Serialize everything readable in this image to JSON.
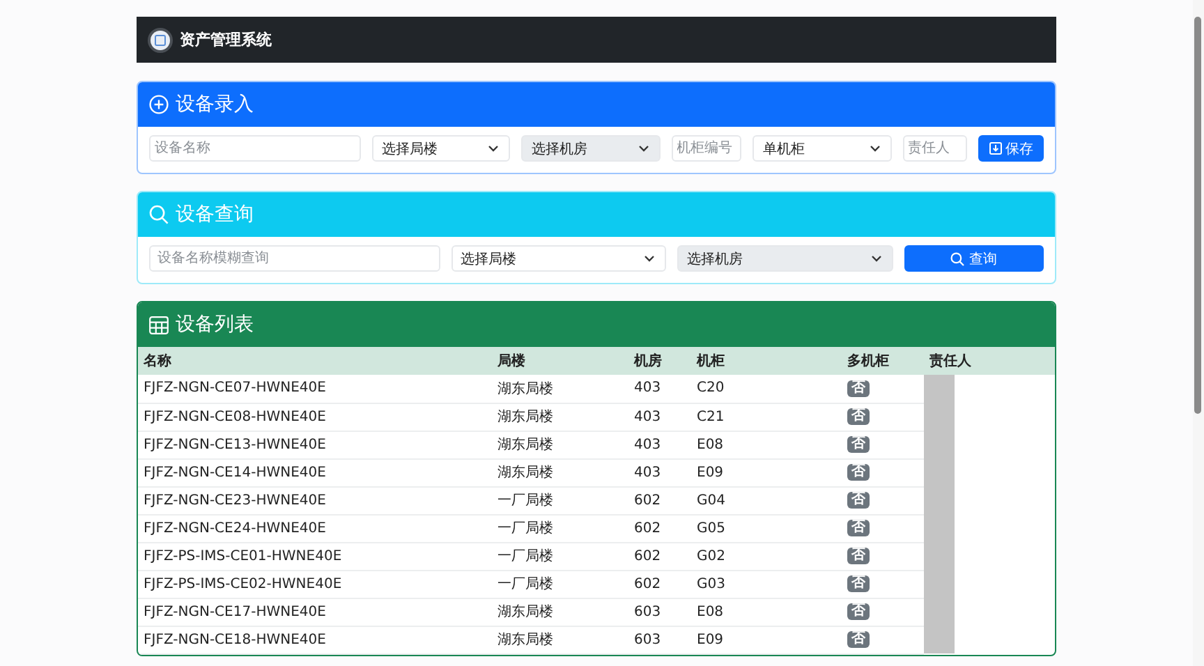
{
  "navbar": {
    "title": "资产管理系统"
  },
  "entry_form": {
    "title": "设备录入",
    "name_field": {
      "placeholder": "设备名称"
    },
    "building_select": {
      "value": "选择局楼",
      "disabled": false
    },
    "room_select": {
      "value": "选择机房",
      "disabled": true
    },
    "cabinet_field": {
      "placeholder": "机柜编号"
    },
    "cabinet_type_select": {
      "value": "单机柜",
      "disabled": false
    },
    "owner_field": {
      "placeholder": "责任人"
    },
    "save_button": "保存"
  },
  "query_form": {
    "title": "设备查询",
    "name_field": {
      "placeholder": "设备名称模糊查询"
    },
    "building_select": {
      "value": "选择局楼",
      "disabled": false
    },
    "room_select": {
      "value": "选择机房",
      "disabled": true
    },
    "query_button": "查询"
  },
  "device_list": {
    "title": "设备列表",
    "columns": [
      "名称",
      "局楼",
      "机房",
      "机柜",
      "多机柜",
      "责任人"
    ],
    "rows": [
      {
        "name": "FJFZ-NGN-CE07-HWNE40E",
        "building": "湖东局楼",
        "room": "403",
        "cabinet": "C20",
        "multi_cabinet": "否"
      },
      {
        "name": "FJFZ-NGN-CE08-HWNE40E",
        "building": "湖东局楼",
        "room": "403",
        "cabinet": "C21",
        "multi_cabinet": "否"
      },
      {
        "name": "FJFZ-NGN-CE13-HWNE40E",
        "building": "湖东局楼",
        "room": "403",
        "cabinet": "E08",
        "multi_cabinet": "否"
      },
      {
        "name": "FJFZ-NGN-CE14-HWNE40E",
        "building": "湖东局楼",
        "room": "403",
        "cabinet": "E09",
        "multi_cabinet": "否"
      },
      {
        "name": "FJFZ-NGN-CE23-HWNE40E",
        "building": "一厂局楼",
        "room": "602",
        "cabinet": "G04",
        "multi_cabinet": "否"
      },
      {
        "name": "FJFZ-NGN-CE24-HWNE40E",
        "building": "一厂局楼",
        "room": "602",
        "cabinet": "G05",
        "multi_cabinet": "否"
      },
      {
        "name": "FJFZ-PS-IMS-CE01-HWNE40E",
        "building": "一厂局楼",
        "room": "602",
        "cabinet": "G02",
        "multi_cabinet": "否"
      },
      {
        "name": "FJFZ-PS-IMS-CE02-HWNE40E",
        "building": "一厂局楼",
        "room": "602",
        "cabinet": "G03",
        "multi_cabinet": "否"
      },
      {
        "name": "FJFZ-NGN-CE17-HWNE40E",
        "building": "湖东局楼",
        "room": "603",
        "cabinet": "E08",
        "multi_cabinet": "否"
      },
      {
        "name": "FJFZ-NGN-CE18-HWNE40E",
        "building": "湖东局楼",
        "room": "603",
        "cabinet": "E09",
        "multi_cabinet": "否"
      }
    ]
  }
}
